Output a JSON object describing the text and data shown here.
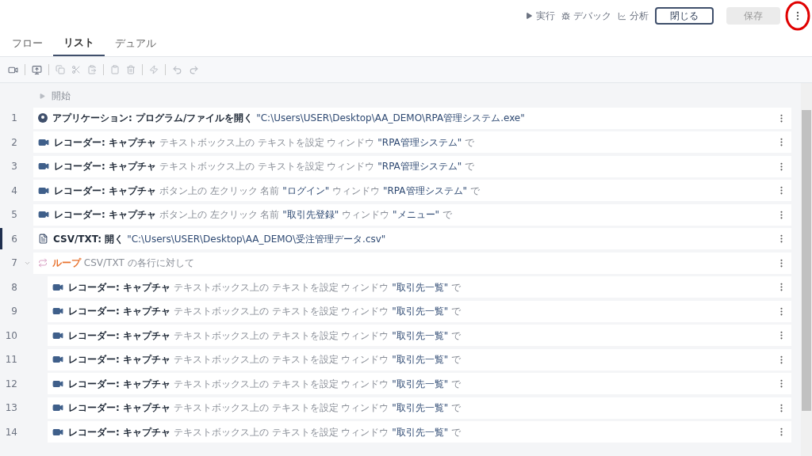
{
  "header_actions": [
    {
      "kind": "run",
      "label": "実行"
    },
    {
      "kind": "debug",
      "label": "デバック"
    },
    {
      "kind": "analyze",
      "label": "分析"
    }
  ],
  "buttons": [
    {
      "label": "閉じる",
      "disabled": false
    },
    {
      "label": "保存",
      "disabled": true
    }
  ],
  "tabs": [
    {
      "label": "フロー",
      "selected": false
    },
    {
      "label": "リスト",
      "selected": true
    },
    {
      "label": "デュアル",
      "selected": false
    }
  ],
  "start_label": "開始",
  "steps": [
    {
      "number": "1",
      "kind": "app",
      "selected": false,
      "indented": false,
      "parts": [
        {
          "kind": "bold",
          "text": "アプリケーション: プログラム/ファイルを開く"
        },
        {
          "kind": "value",
          "text": "\"C:\\Users\\USER\\Desktop\\AA_DEMO\\RPA管理システム.exe\""
        }
      ]
    },
    {
      "number": "2",
      "kind": "recorder",
      "selected": false,
      "indented": false,
      "parts": [
        {
          "kind": "bold",
          "text": "レコーダー: キャプチャ"
        },
        {
          "kind": "plain",
          "text": "テキストボックス上の テキストを設定 ウィンドウ"
        },
        {
          "kind": "value",
          "text": "\"RPA管理システム\""
        },
        {
          "kind": "plain",
          "text": "で"
        }
      ]
    },
    {
      "number": "3",
      "kind": "recorder",
      "selected": false,
      "indented": false,
      "parts": [
        {
          "kind": "bold",
          "text": "レコーダー: キャプチャ"
        },
        {
          "kind": "plain",
          "text": "テキストボックス上の テキストを設定 ウィンドウ"
        },
        {
          "kind": "value",
          "text": "\"RPA管理システム\""
        },
        {
          "kind": "plain",
          "text": "で"
        }
      ]
    },
    {
      "number": "4",
      "kind": "recorder",
      "selected": false,
      "indented": false,
      "parts": [
        {
          "kind": "bold",
          "text": "レコーダー: キャプチャ"
        },
        {
          "kind": "plain",
          "text": "ボタン上の 左クリック 名前"
        },
        {
          "kind": "value",
          "text": "\"ログイン\""
        },
        {
          "kind": "plain",
          "text": "ウィンドウ"
        },
        {
          "kind": "value",
          "text": "\"RPA管理システム\""
        },
        {
          "kind": "plain",
          "text": "で"
        }
      ]
    },
    {
      "number": "5",
      "kind": "recorder",
      "selected": false,
      "indented": false,
      "parts": [
        {
          "kind": "bold",
          "text": "レコーダー: キャプチャ"
        },
        {
          "kind": "plain",
          "text": "ボタン上の 左クリック 名前"
        },
        {
          "kind": "value",
          "text": "\"取引先登録\""
        },
        {
          "kind": "plain",
          "text": "ウィンドウ"
        },
        {
          "kind": "value",
          "text": "\"メニュー\""
        },
        {
          "kind": "plain",
          "text": "で"
        }
      ]
    },
    {
      "number": "6",
      "kind": "file",
      "selected": true,
      "indented": false,
      "parts": [
        {
          "kind": "bold",
          "text": "CSV/TXT: 開く"
        },
        {
          "kind": "value",
          "text": "\"C:\\Users\\USER\\Desktop\\AA_DEMO\\受注管理データ.csv\""
        }
      ]
    },
    {
      "number": "7",
      "kind": "loop",
      "selected": false,
      "indented": false,
      "expanded": true,
      "parts": [
        {
          "kind": "loop",
          "text": "ループ"
        },
        {
          "kind": "plain",
          "text": "CSV/TXT の各行に対して"
        }
      ]
    },
    {
      "number": "8",
      "kind": "recorder",
      "selected": false,
      "indented": true,
      "parts": [
        {
          "kind": "bold",
          "text": "レコーダー: キャプチャ"
        },
        {
          "kind": "plain",
          "text": "テキストボックス上の テキストを設定 ウィンドウ"
        },
        {
          "kind": "value",
          "text": "\"取引先一覧\""
        },
        {
          "kind": "plain",
          "text": "で"
        }
      ]
    },
    {
      "number": "9",
      "kind": "recorder",
      "selected": false,
      "indented": true,
      "parts": [
        {
          "kind": "bold",
          "text": "レコーダー: キャプチャ"
        },
        {
          "kind": "plain",
          "text": "テキストボックス上の テキストを設定 ウィンドウ"
        },
        {
          "kind": "value",
          "text": "\"取引先一覧\""
        },
        {
          "kind": "plain",
          "text": "で"
        }
      ]
    },
    {
      "number": "10",
      "kind": "recorder",
      "selected": false,
      "indented": true,
      "parts": [
        {
          "kind": "bold",
          "text": "レコーダー: キャプチャ"
        },
        {
          "kind": "plain",
          "text": "テキストボックス上の テキストを設定 ウィンドウ"
        },
        {
          "kind": "value",
          "text": "\"取引先一覧\""
        },
        {
          "kind": "plain",
          "text": "で"
        }
      ]
    },
    {
      "number": "11",
      "kind": "recorder",
      "selected": false,
      "indented": true,
      "parts": [
        {
          "kind": "bold",
          "text": "レコーダー: キャプチャ"
        },
        {
          "kind": "plain",
          "text": "テキストボックス上の テキストを設定 ウィンドウ"
        },
        {
          "kind": "value",
          "text": "\"取引先一覧\""
        },
        {
          "kind": "plain",
          "text": "で"
        }
      ]
    },
    {
      "number": "12",
      "kind": "recorder",
      "selected": false,
      "indented": true,
      "parts": [
        {
          "kind": "bold",
          "text": "レコーダー: キャプチャ"
        },
        {
          "kind": "plain",
          "text": "テキストボックス上の テキストを設定 ウィンドウ"
        },
        {
          "kind": "value",
          "text": "\"取引先一覧\""
        },
        {
          "kind": "plain",
          "text": "で"
        }
      ]
    },
    {
      "number": "13",
      "kind": "recorder",
      "selected": false,
      "indented": true,
      "parts": [
        {
          "kind": "bold",
          "text": "レコーダー: キャプチャ"
        },
        {
          "kind": "plain",
          "text": "テキストボックス上の テキストを設定 ウィンドウ"
        },
        {
          "kind": "value",
          "text": "\"取引先一覧\""
        },
        {
          "kind": "plain",
          "text": "で"
        }
      ]
    },
    {
      "number": "14",
      "kind": "recorder",
      "selected": false,
      "indented": true,
      "parts": [
        {
          "kind": "bold",
          "text": "レコーダー: キャプチャ"
        },
        {
          "kind": "plain",
          "text": "テキストボックス上の テキストを設定 ウィンドウ"
        },
        {
          "kind": "value",
          "text": "\"取引先一覧\""
        },
        {
          "kind": "plain",
          "text": "で"
        }
      ]
    }
  ]
}
